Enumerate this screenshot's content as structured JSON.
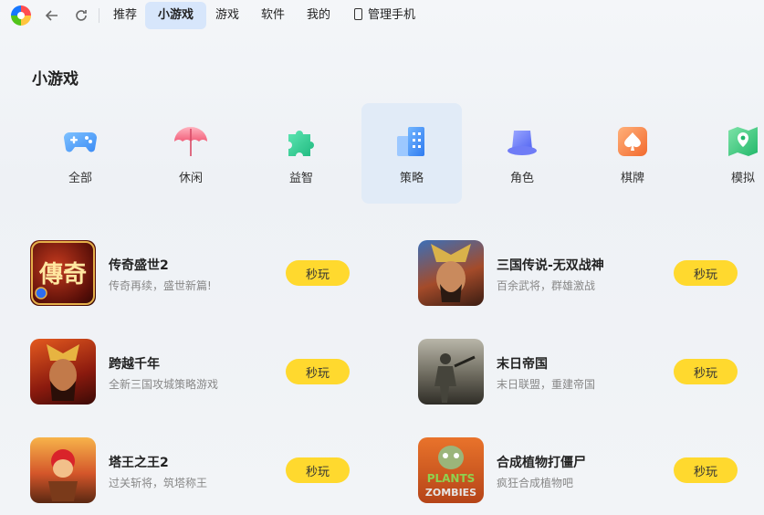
{
  "nav": {
    "tabs": [
      {
        "label": "推荐",
        "active": false
      },
      {
        "label": "小游戏",
        "active": true
      },
      {
        "label": "游戏",
        "active": false
      },
      {
        "label": "软件",
        "active": false
      },
      {
        "label": "我的",
        "active": false
      }
    ],
    "phone_label": "管理手机"
  },
  "section_title": "小游戏",
  "categories": [
    {
      "label": "全部",
      "icon": "gamepad-icon"
    },
    {
      "label": "休闲",
      "icon": "umbrella-icon"
    },
    {
      "label": "益智",
      "icon": "puzzle-icon"
    },
    {
      "label": "策略",
      "icon": "buildings-icon"
    },
    {
      "label": "角色",
      "icon": "hat-icon"
    },
    {
      "label": "棋牌",
      "icon": "spade-card-icon"
    },
    {
      "label": "模拟",
      "icon": "map-pin-icon"
    }
  ],
  "selected_category": "策略",
  "play_label": "秒玩",
  "games": [
    {
      "name": "传奇盛世2",
      "desc": "传奇再续，盛世新篇!"
    },
    {
      "name": "三国传说-无双战神",
      "desc": "百余武将，群雄激战"
    },
    {
      "name": "跨越千年",
      "desc": "全新三国攻城策略游戏"
    },
    {
      "name": "末日帝国",
      "desc": "末日联盟，重建帝国"
    },
    {
      "name": "塔王之王2",
      "desc": "过关斩将，筑塔称王"
    },
    {
      "name": "合成植物打僵尸",
      "desc": "疯狂合成植物吧"
    }
  ],
  "thumb_texts": {
    "legend": "傳奇",
    "plants_line1": "PLANTS",
    "plants_line2": "ZOMBIES"
  },
  "colors": {
    "accent_play": "#ffd92e",
    "active_tab": "#d7e6fb",
    "selected_category_bg": "#e1ebf7"
  }
}
